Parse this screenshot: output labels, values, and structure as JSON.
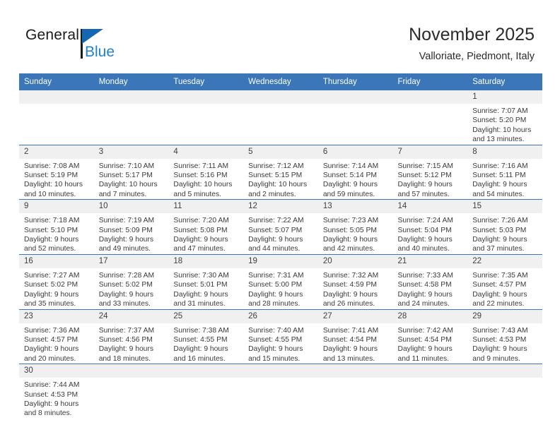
{
  "brand": {
    "name_top": "General",
    "name_bottom": "Blue",
    "accent_color": "#1667b2",
    "blue_text_color": "#1f82d0"
  },
  "header": {
    "title": "November 2025",
    "subtitle": "Valloriate, Piedmont, Italy"
  },
  "theme": {
    "header_row_bg": "#3a76b8",
    "daynum_bg": "#f0f0f0",
    "grid_line": "#3a76b8",
    "text": "#2b2b2b"
  },
  "weekday_headers": [
    "Sunday",
    "Monday",
    "Tuesday",
    "Wednesday",
    "Thursday",
    "Friday",
    "Saturday"
  ],
  "labels": {
    "sunrise_prefix": "Sunrise:",
    "sunset_prefix": "Sunset:",
    "daylight_prefix": "Daylight:"
  },
  "weeks": [
    [
      {
        "day": "",
        "lines": []
      },
      {
        "day": "",
        "lines": []
      },
      {
        "day": "",
        "lines": []
      },
      {
        "day": "",
        "lines": []
      },
      {
        "day": "",
        "lines": []
      },
      {
        "day": "",
        "lines": []
      },
      {
        "day": "1",
        "lines": [
          "Sunrise: 7:07 AM",
          "Sunset: 5:20 PM",
          "Daylight: 10 hours",
          "and 13 minutes."
        ]
      }
    ],
    [
      {
        "day": "2",
        "lines": [
          "Sunrise: 7:08 AM",
          "Sunset: 5:19 PM",
          "Daylight: 10 hours",
          "and 10 minutes."
        ]
      },
      {
        "day": "3",
        "lines": [
          "Sunrise: 7:10 AM",
          "Sunset: 5:17 PM",
          "Daylight: 10 hours",
          "and 7 minutes."
        ]
      },
      {
        "day": "4",
        "lines": [
          "Sunrise: 7:11 AM",
          "Sunset: 5:16 PM",
          "Daylight: 10 hours",
          "and 5 minutes."
        ]
      },
      {
        "day": "5",
        "lines": [
          "Sunrise: 7:12 AM",
          "Sunset: 5:15 PM",
          "Daylight: 10 hours",
          "and 2 minutes."
        ]
      },
      {
        "day": "6",
        "lines": [
          "Sunrise: 7:14 AM",
          "Sunset: 5:14 PM",
          "Daylight: 9 hours",
          "and 59 minutes."
        ]
      },
      {
        "day": "7",
        "lines": [
          "Sunrise: 7:15 AM",
          "Sunset: 5:12 PM",
          "Daylight: 9 hours",
          "and 57 minutes."
        ]
      },
      {
        "day": "8",
        "lines": [
          "Sunrise: 7:16 AM",
          "Sunset: 5:11 PM",
          "Daylight: 9 hours",
          "and 54 minutes."
        ]
      }
    ],
    [
      {
        "day": "9",
        "lines": [
          "Sunrise: 7:18 AM",
          "Sunset: 5:10 PM",
          "Daylight: 9 hours",
          "and 52 minutes."
        ]
      },
      {
        "day": "10",
        "lines": [
          "Sunrise: 7:19 AM",
          "Sunset: 5:09 PM",
          "Daylight: 9 hours",
          "and 49 minutes."
        ]
      },
      {
        "day": "11",
        "lines": [
          "Sunrise: 7:20 AM",
          "Sunset: 5:08 PM",
          "Daylight: 9 hours",
          "and 47 minutes."
        ]
      },
      {
        "day": "12",
        "lines": [
          "Sunrise: 7:22 AM",
          "Sunset: 5:07 PM",
          "Daylight: 9 hours",
          "and 44 minutes."
        ]
      },
      {
        "day": "13",
        "lines": [
          "Sunrise: 7:23 AM",
          "Sunset: 5:05 PM",
          "Daylight: 9 hours",
          "and 42 minutes."
        ]
      },
      {
        "day": "14",
        "lines": [
          "Sunrise: 7:24 AM",
          "Sunset: 5:04 PM",
          "Daylight: 9 hours",
          "and 40 minutes."
        ]
      },
      {
        "day": "15",
        "lines": [
          "Sunrise: 7:26 AM",
          "Sunset: 5:03 PM",
          "Daylight: 9 hours",
          "and 37 minutes."
        ]
      }
    ],
    [
      {
        "day": "16",
        "lines": [
          "Sunrise: 7:27 AM",
          "Sunset: 5:02 PM",
          "Daylight: 9 hours",
          "and 35 minutes."
        ]
      },
      {
        "day": "17",
        "lines": [
          "Sunrise: 7:28 AM",
          "Sunset: 5:02 PM",
          "Daylight: 9 hours",
          "and 33 minutes."
        ]
      },
      {
        "day": "18",
        "lines": [
          "Sunrise: 7:30 AM",
          "Sunset: 5:01 PM",
          "Daylight: 9 hours",
          "and 31 minutes."
        ]
      },
      {
        "day": "19",
        "lines": [
          "Sunrise: 7:31 AM",
          "Sunset: 5:00 PM",
          "Daylight: 9 hours",
          "and 28 minutes."
        ]
      },
      {
        "day": "20",
        "lines": [
          "Sunrise: 7:32 AM",
          "Sunset: 4:59 PM",
          "Daylight: 9 hours",
          "and 26 minutes."
        ]
      },
      {
        "day": "21",
        "lines": [
          "Sunrise: 7:33 AM",
          "Sunset: 4:58 PM",
          "Daylight: 9 hours",
          "and 24 minutes."
        ]
      },
      {
        "day": "22",
        "lines": [
          "Sunrise: 7:35 AM",
          "Sunset: 4:57 PM",
          "Daylight: 9 hours",
          "and 22 minutes."
        ]
      }
    ],
    [
      {
        "day": "23",
        "lines": [
          "Sunrise: 7:36 AM",
          "Sunset: 4:57 PM",
          "Daylight: 9 hours",
          "and 20 minutes."
        ]
      },
      {
        "day": "24",
        "lines": [
          "Sunrise: 7:37 AM",
          "Sunset: 4:56 PM",
          "Daylight: 9 hours",
          "and 18 minutes."
        ]
      },
      {
        "day": "25",
        "lines": [
          "Sunrise: 7:38 AM",
          "Sunset: 4:55 PM",
          "Daylight: 9 hours",
          "and 16 minutes."
        ]
      },
      {
        "day": "26",
        "lines": [
          "Sunrise: 7:40 AM",
          "Sunset: 4:55 PM",
          "Daylight: 9 hours",
          "and 15 minutes."
        ]
      },
      {
        "day": "27",
        "lines": [
          "Sunrise: 7:41 AM",
          "Sunset: 4:54 PM",
          "Daylight: 9 hours",
          "and 13 minutes."
        ]
      },
      {
        "day": "28",
        "lines": [
          "Sunrise: 7:42 AM",
          "Sunset: 4:54 PM",
          "Daylight: 9 hours",
          "and 11 minutes."
        ]
      },
      {
        "day": "29",
        "lines": [
          "Sunrise: 7:43 AM",
          "Sunset: 4:53 PM",
          "Daylight: 9 hours",
          "and 9 minutes."
        ]
      }
    ],
    [
      {
        "day": "30",
        "lines": [
          "Sunrise: 7:44 AM",
          "Sunset: 4:53 PM",
          "Daylight: 9 hours",
          "and 8 minutes."
        ]
      },
      {
        "day": "",
        "lines": []
      },
      {
        "day": "",
        "lines": []
      },
      {
        "day": "",
        "lines": []
      },
      {
        "day": "",
        "lines": []
      },
      {
        "day": "",
        "lines": []
      },
      {
        "day": "",
        "lines": []
      }
    ]
  ]
}
